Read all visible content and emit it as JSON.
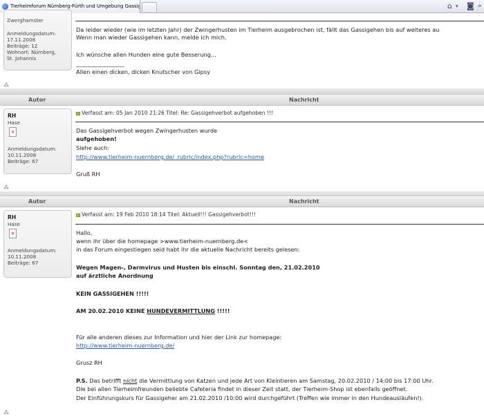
{
  "tab": {
    "title": "Tierheimforum Nürnberg-Fürth und Umgebung Gassig..."
  },
  "columns": {
    "author": "Autor",
    "message": "Nachricht"
  },
  "post0": {
    "rank": "Zwerghamster",
    "info": [
      "Anmeldungsdatum:",
      "17.11.2008",
      "Beiträge: 12",
      "Wohnort: Nürnberg,",
      "St. Johannis"
    ],
    "lines": [
      "Da leider wieder (wie im letzten Jahr) der Zwingerhusten im Tierheim ausgebrochen ist, fällt das Gassigehen bis auf weiteres au",
      "Wenn man wieder Gassigehen kann, melde ich mich.",
      "Ich wünsche allen Hunden eine gute Besserung...",
      "Allen einen dicken, dicken Knutscher von Gipsy"
    ],
    "signature_rule": "_________________"
  },
  "post1": {
    "user": "RH",
    "rank": "Hase",
    "info": [
      "Anmeldungsdatum:",
      "10.11.2008",
      "Beiträge: 67"
    ],
    "meta": "Verfasst am: 05 Jan 2010 21:26    Titel: Re: Gassigehverbot aufgehoben !!!",
    "lines": [
      "Das Gassigehverbot wegen Zwingerhusten wurde",
      "aufgehoben!",
      "Siehe auch:"
    ],
    "link": "http://www.tierheim-nuernberg.de/_rubric/index.php?rubric=home",
    "greeting": "Gruß RH"
  },
  "post2": {
    "user": "RH",
    "rank": "Hase",
    "info": [
      "Anmeldungsdatum:",
      "10.11.2008",
      "Beiträge: 67"
    ],
    "meta": "Verfasst am: 19 Feb 2010 18:14    Titel: Aktuell!!! Gassigehverbot!!!",
    "intro": [
      "Hallo,",
      "wenn ihr über die homepage >www.tierheim-nuernberg.de<",
      "in das Forum eingestiegen seid habt ihr die aktuelle Nachricht bereits gelesen:"
    ],
    "bold1": "Wegen Magen-, Darmvirus und Husten bis einschl. Sonntag den, 21.02.2010",
    "bold2": "auf ärztliche Anordnung",
    "bold3": "KEIN GASSIGEHEN !!!!!",
    "bold4_pre": "AM 20.02.2010 KEINE ",
    "bold4_u": "HUNDEVERMITTLUNG",
    "bold4_post": " !!!!!",
    "info_line": "Für alle anderen dieses zur Information und hier der Link zur homepage:",
    "link": "http://www.tierheim-nuernberg.de/",
    "greeting": "Grusz RH",
    "ps_label": "P.S.",
    "ps_pre": " Das betrifft ",
    "ps_u": "nicht",
    "ps_post": " die Vermittlung von Katzen und jede Art von Kleintieren am Samstag, 20.02.2010 / 14:00 bis 17:00 Uhr.",
    "ps2": "Die bei allen Tierheimfreunden beliebte Cafeteria findet in dieser Zeit statt, der Tierheim-Shop ist ebenfalls geöffnet.",
    "ps3": "Der Einführungskurs für Gassigeher am 21.02.2010 /10:00 wird durchgeführt (Treffen wie immer in den Hundeausläufen!)."
  }
}
